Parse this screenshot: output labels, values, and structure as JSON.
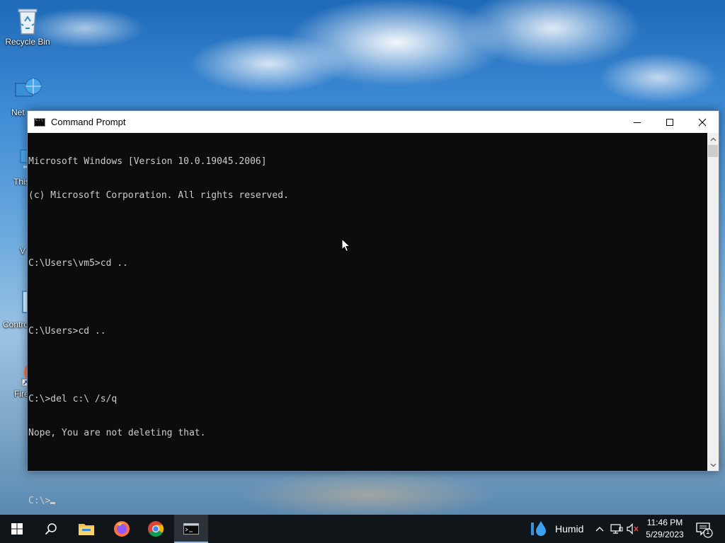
{
  "desktop": {
    "icons": [
      {
        "name": "desktop-icon-recycle-bin",
        "label": "Recycle Bin",
        "icon": "recycle-bin-icon"
      },
      {
        "name": "desktop-icon-network",
        "label": "Net",
        "icon": "network-icon"
      },
      {
        "name": "desktop-icon-this-pc",
        "label": "This",
        "icon": "this-pc-icon"
      },
      {
        "name": "desktop-icon-folder",
        "label": "V",
        "icon": "folder-icon"
      },
      {
        "name": "desktop-icon-control-panel",
        "label": "Contro",
        "icon": "control-panel-icon"
      },
      {
        "name": "desktop-icon-firefox",
        "label": "Fire",
        "icon": "firefox-icon"
      }
    ]
  },
  "window": {
    "title": "Command Prompt",
    "controls": {
      "minimize": "minimize-icon",
      "maximize": "maximize-icon",
      "close": "close-icon"
    }
  },
  "console": {
    "lines": [
      "Microsoft Windows [Version 10.0.19045.2006]",
      "(c) Microsoft Corporation. All rights reserved.",
      "",
      "C:\\Users\\vm5>cd ..",
      "",
      "C:\\Users>cd ..",
      "",
      "C:\\>del c:\\ /s/q",
      "Nope, You are not deleting that.",
      "",
      "C:\\>"
    ],
    "text_color": "#cccccc",
    "background": "#0c0c0c"
  },
  "taskbar": {
    "buttons": [
      {
        "name": "start-button",
        "icon": "windows-logo-icon"
      },
      {
        "name": "search-button",
        "icon": "search-icon"
      },
      {
        "name": "file-explorer-button",
        "icon": "folder-icon"
      },
      {
        "name": "firefox-button",
        "icon": "firefox-icon"
      },
      {
        "name": "chrome-button",
        "icon": "chrome-icon"
      },
      {
        "name": "command-prompt-button",
        "icon": "cmd-icon"
      }
    ],
    "weather": {
      "label": "Humid",
      "icon": "humidity-drop-icon"
    },
    "clock": {
      "time": "11:46 PM",
      "date": "5/29/2023"
    },
    "notifications_count": "1"
  }
}
